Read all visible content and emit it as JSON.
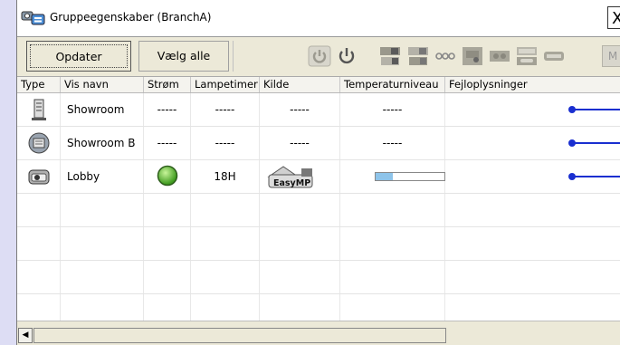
{
  "window": {
    "title": "Gruppeegenskaber (BranchA)",
    "close_glyph": "X"
  },
  "toolbar": {
    "update_label": "Opdater",
    "select_all_label": "Vælg alle",
    "icons": [
      "power-on-icon",
      "power-off-icon",
      "source-computer1-icon",
      "source-computer2-icon",
      "source-video-icon",
      "source-svideo-icon",
      "source-component-icon",
      "source-rgb-icon",
      "av-mute-icon",
      "mute-icon"
    ],
    "overflow_label": "M"
  },
  "table": {
    "headers": [
      "Type",
      "Vis navn",
      "Strøm",
      "Lampetimer",
      "Kilde",
      "Temperaturniveau",
      "Fejloplysninger"
    ],
    "rows": [
      {
        "type_icon": "projector-tower-icon",
        "name": "Showroom",
        "power": "-----",
        "lamp_hours": "-----",
        "source": "-----",
        "temperature": "-----",
        "error": ""
      },
      {
        "type_icon": "projector-screen-icon",
        "name": "Showroom B",
        "power": "-----",
        "lamp_hours": "-----",
        "source": "-----",
        "temperature": "-----",
        "error": ""
      },
      {
        "type_icon": "projector-icon",
        "name": "Lobby",
        "power": "on",
        "lamp_hours": "18H",
        "source": "EasyMP",
        "temperature_level": 0.25,
        "error": ""
      }
    ],
    "empty_rows": 4
  },
  "colors": {
    "callout": "#1a2fd0",
    "power_on": "#4caf2a"
  }
}
